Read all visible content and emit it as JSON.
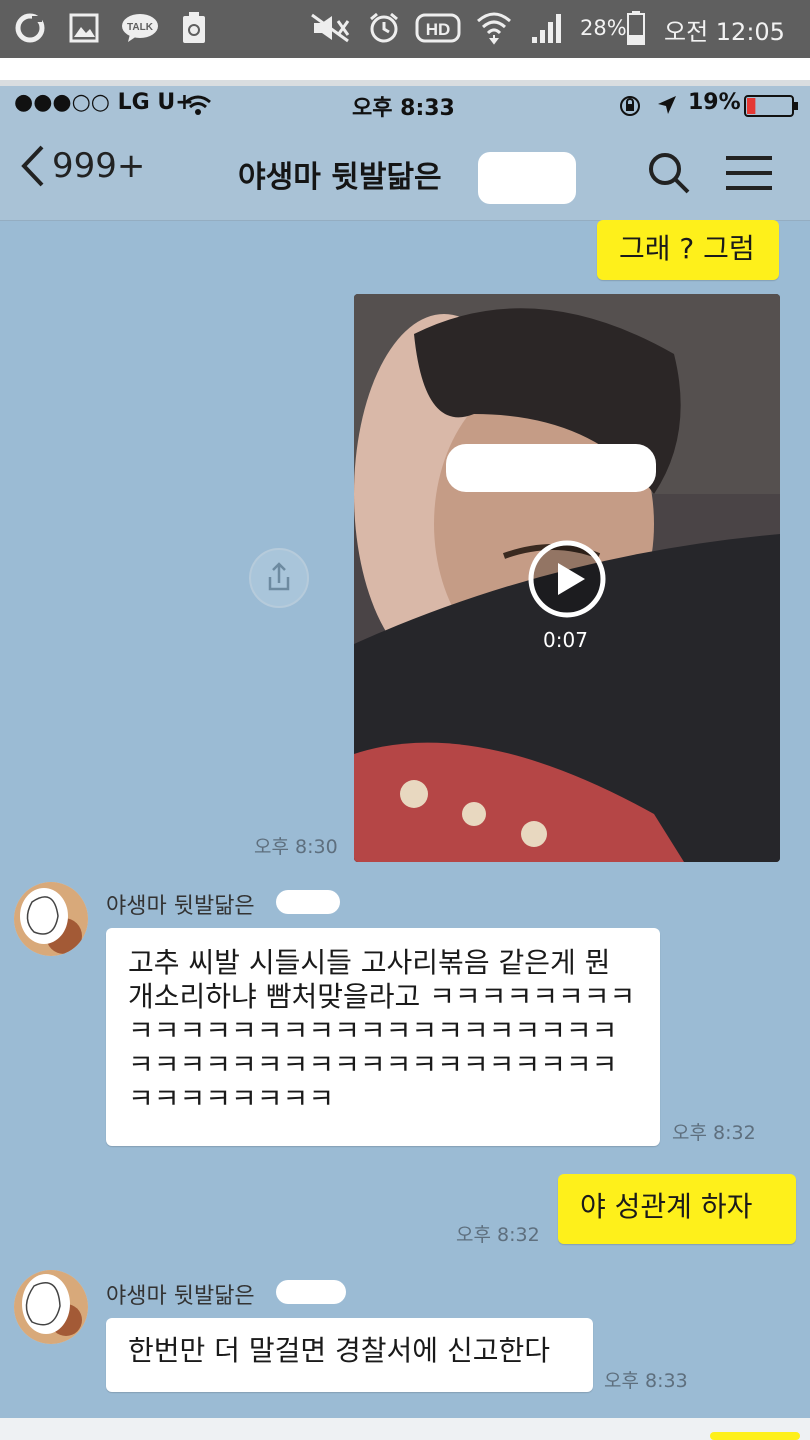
{
  "android_status": {
    "battery": "28%",
    "time": "오전 12:05",
    "icons": [
      "o-app-icon",
      "gallery-icon",
      "talk-icon",
      "recycle-icon",
      "mute-icon",
      "alarm-icon",
      "hd-icon",
      "wifi-icon",
      "signal-icon",
      "battery-icon"
    ],
    "talk_label": "TALK",
    "hd_label": "HD"
  },
  "ios_status": {
    "carrier": "●●●○○ LG U+",
    "time": "오후 8:33",
    "battery": "19%",
    "battery_color": "#e53935"
  },
  "header": {
    "back_count": "999+",
    "title": "야생마 뒷발닮은"
  },
  "messages": [
    {
      "type": "sent",
      "text": "그래 ? 그럼",
      "time": ""
    },
    {
      "type": "video",
      "duration": "0:07",
      "time": "오후 8:30"
    },
    {
      "type": "received",
      "sender": "야생마 뒷발닮은",
      "text": "고추 씨발 시들시들 고사리볶음 같은게 뭔 개소리하냐 빰처맞을라고 ㅋㅋㅋㅋㅋㅋㅋㅋㅋㅋㅋㅋㅋㅋㅋㅋㅋㅋㅋㅋㅋㅋㅋㅋㅋㅋㅋㅋㅋㅋㅋㅋㅋㅋㅋㅋㅋㅋㅋㅋㅋㅋㅋㅋㅋㅋㅋㅋㅋㅋㅋㅋㅋㅋ",
      "time": "오후 8:32"
    },
    {
      "type": "sent",
      "text": "야 성관계 하자",
      "time": "오후 8:32"
    },
    {
      "type": "received",
      "sender": "야생마 뒷발닮은",
      "text": "한번만 더 말걸면 경찰서에 신고한다",
      "time": "오후 8:33"
    }
  ],
  "colors": {
    "chat_bg": "#9bbbd4",
    "sent_bubble": "#fef01b",
    "received_bubble": "#ffffff"
  }
}
